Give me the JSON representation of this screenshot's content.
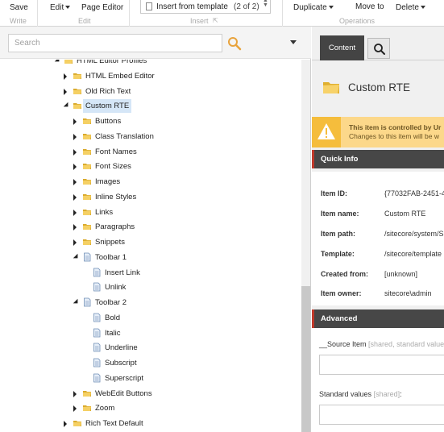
{
  "ribbon": {
    "save": "Save",
    "write_caption": "Write",
    "edit": "Edit",
    "page_editor": "Page Editor",
    "edit_caption": "Edit",
    "insert_from_template": "Insert from template",
    "insert_count": "(2 of 2)",
    "insert_caption": "Insert",
    "duplicate": "Duplicate",
    "move_to": "Move to",
    "delete": "Delete",
    "operations_caption": "Operations"
  },
  "search": {
    "placeholder": "Search",
    "value": ""
  },
  "tree": [
    {
      "label": "HTML Editor Profiles",
      "level": 0,
      "state": "open",
      "icon": "folder-icon"
    },
    {
      "label": "HTML Embed Editor",
      "level": 1,
      "state": "closed",
      "icon": "folder-icon"
    },
    {
      "label": "Old Rich Text",
      "level": 1,
      "state": "closed",
      "icon": "folder-icon"
    },
    {
      "label": "Custom RTE",
      "level": 1,
      "state": "open",
      "icon": "folder-icon",
      "selected": true
    },
    {
      "label": "Buttons",
      "level": 2,
      "state": "closed",
      "icon": "folder-icon"
    },
    {
      "label": "Class Translation",
      "level": 2,
      "state": "closed",
      "icon": "folder-icon"
    },
    {
      "label": "Font Names",
      "level": 2,
      "state": "closed",
      "icon": "folder-icon"
    },
    {
      "label": "Font Sizes",
      "level": 2,
      "state": "closed",
      "icon": "folder-icon"
    },
    {
      "label": "Images",
      "level": 2,
      "state": "closed",
      "icon": "folder-icon"
    },
    {
      "label": "Inline Styles",
      "level": 2,
      "state": "closed",
      "icon": "folder-icon"
    },
    {
      "label": "Links",
      "level": 2,
      "state": "closed",
      "icon": "folder-icon"
    },
    {
      "label": "Paragraphs",
      "level": 2,
      "state": "closed",
      "icon": "folder-icon"
    },
    {
      "label": "Snippets",
      "level": 2,
      "state": "closed",
      "icon": "folder-icon"
    },
    {
      "label": "Toolbar 1",
      "level": 2,
      "state": "open",
      "icon": "document-icon"
    },
    {
      "label": "Insert Link",
      "level": 3,
      "state": "leaf",
      "icon": "document-icon"
    },
    {
      "label": "Unlink",
      "level": 3,
      "state": "leaf",
      "icon": "document-icon"
    },
    {
      "label": "Toolbar 2",
      "level": 2,
      "state": "open",
      "icon": "document-icon"
    },
    {
      "label": "Bold",
      "level": 3,
      "state": "leaf",
      "icon": "document-icon"
    },
    {
      "label": "Italic",
      "level": 3,
      "state": "leaf",
      "icon": "document-icon"
    },
    {
      "label": "Underline",
      "level": 3,
      "state": "leaf",
      "icon": "document-icon"
    },
    {
      "label": "Subscript",
      "level": 3,
      "state": "leaf",
      "icon": "document-icon"
    },
    {
      "label": "Superscript",
      "level": 3,
      "state": "leaf",
      "icon": "document-icon"
    },
    {
      "label": "WebEdit Buttons",
      "level": 2,
      "state": "closed",
      "icon": "folder-icon"
    },
    {
      "label": "Zoom",
      "level": 2,
      "state": "closed",
      "icon": "folder-icon"
    },
    {
      "label": "Rich Text Default",
      "level": 1,
      "state": "closed",
      "icon": "folder-icon"
    }
  ],
  "editor": {
    "tab_content": "Content",
    "item_title": "Custom RTE",
    "warning_line1": "This item is controlled by Ur",
    "warning_line2": "Changes to this item will be w",
    "quick_info_title": "Quick Info",
    "quick_info": [
      {
        "key": "Item ID:",
        "value": "{77032FAB-2451-4"
      },
      {
        "key": "Item name:",
        "value": "Custom RTE"
      },
      {
        "key": "Item path:",
        "value": "/sitecore/system/S"
      },
      {
        "key": "Template:",
        "value": "/sitecore/template"
      },
      {
        "key": "Created from:",
        "value": "[unknown]"
      },
      {
        "key": "Item owner:",
        "value": "sitecore\\admin"
      }
    ],
    "advanced_title": "Advanced",
    "source_item_label": "__Source Item",
    "source_item_sub": "[shared, standard value",
    "standard_values_label": "Standard values",
    "standard_values_sub": "[shared]",
    "standard_values_colon": ":"
  },
  "colors": {
    "accent_red": "#c0392b",
    "section_dark": "#474747",
    "warning_bg": "#fcd88a",
    "folder_yellow": "#f2c94c",
    "selection_blue": "#d5e6f7"
  }
}
